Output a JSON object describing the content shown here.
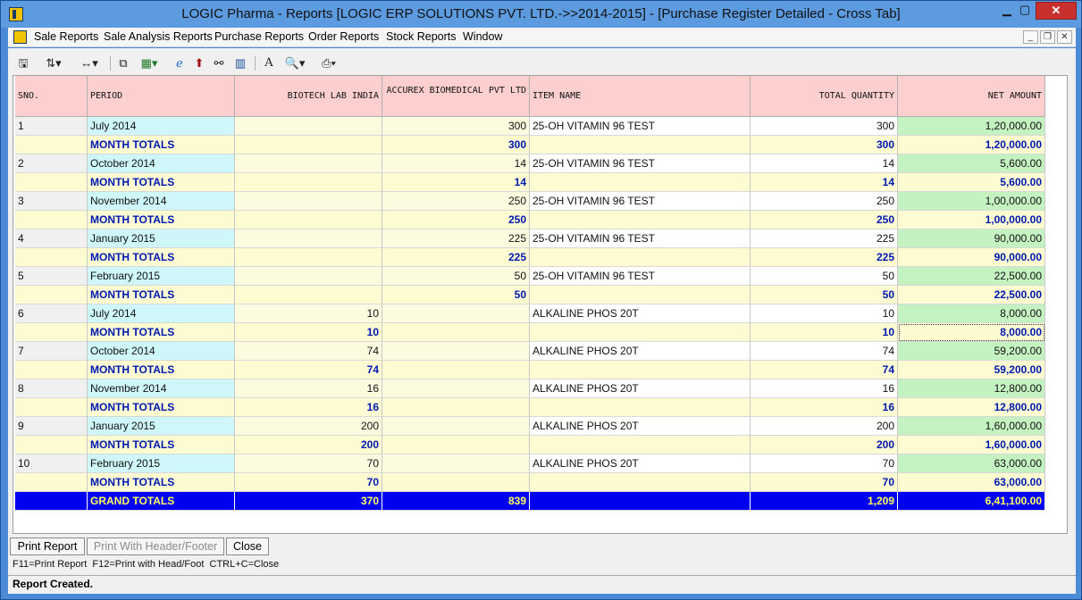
{
  "window": {
    "title": "LOGIC Pharma - Reports  [LOGIC ERP SOLUTIONS PVT. LTD.->>2014-2015] - [Purchase Register Detailed - Cross Tab]",
    "controls": {
      "minimize": "▁",
      "maximize": "▢",
      "close": "✕"
    }
  },
  "menu": {
    "items": [
      "Sale Reports",
      "Sale Analysis Reports",
      "Purchase Reports",
      "Order Reports",
      "Stock Reports",
      "Window"
    ],
    "mdi": {
      "minimize": "_",
      "restore": "❐",
      "close": "✕"
    }
  },
  "toolbar": {
    "icons": [
      "save-icon",
      "sort-icon",
      "column-width-icon",
      "copy-icon",
      "excel-icon",
      "internet-explorer-icon",
      "up-arrow-icon",
      "binoculars-icon",
      "chart-icon",
      "font-icon",
      "print-preview-icon",
      "printer-icon"
    ]
  },
  "table": {
    "headers": {
      "sno": "SNO.",
      "period": "PERIOD",
      "biotech": "BIOTECH LAB INDIA",
      "accurex": "ACCUREX BIOMEDICAL PVT LTD",
      "item": "ITEM NAME",
      "qty": "TOTAL QUANTITY",
      "net": "NET AMOUNT"
    },
    "rows": [
      {
        "type": "detail",
        "sno": "1",
        "period": "July 2014",
        "biotech": "",
        "accurex": "300",
        "item": "25-OH VITAMIN 96 TEST",
        "qty": "300",
        "net": "1,20,000.00"
      },
      {
        "type": "total",
        "sno": "",
        "period": "MONTH TOTALS",
        "biotech": "",
        "accurex": "300",
        "item": "",
        "qty": "300",
        "net": "1,20,000.00"
      },
      {
        "type": "detail",
        "sno": "2",
        "period": "October 2014",
        "biotech": "",
        "accurex": "14",
        "item": "25-OH VITAMIN 96 TEST",
        "qty": "14",
        "net": "5,600.00"
      },
      {
        "type": "total",
        "sno": "",
        "period": "MONTH TOTALS",
        "biotech": "",
        "accurex": "14",
        "item": "",
        "qty": "14",
        "net": "5,600.00"
      },
      {
        "type": "detail",
        "sno": "3",
        "period": "November 2014",
        "biotech": "",
        "accurex": "250",
        "item": "25-OH VITAMIN 96 TEST",
        "qty": "250",
        "net": "1,00,000.00"
      },
      {
        "type": "total",
        "sno": "",
        "period": "MONTH TOTALS",
        "biotech": "",
        "accurex": "250",
        "item": "",
        "qty": "250",
        "net": "1,00,000.00"
      },
      {
        "type": "detail",
        "sno": "4",
        "period": "January 2015",
        "biotech": "",
        "accurex": "225",
        "item": "25-OH VITAMIN 96 TEST",
        "qty": "225",
        "net": "90,000.00"
      },
      {
        "type": "total",
        "sno": "",
        "period": "MONTH TOTALS",
        "biotech": "",
        "accurex": "225",
        "item": "",
        "qty": "225",
        "net": "90,000.00"
      },
      {
        "type": "detail",
        "sno": "5",
        "period": "February 2015",
        "biotech": "",
        "accurex": "50",
        "item": "25-OH VITAMIN 96 TEST",
        "qty": "50",
        "net": "22,500.00"
      },
      {
        "type": "total",
        "sno": "",
        "period": "MONTH TOTALS",
        "biotech": "",
        "accurex": "50",
        "item": "",
        "qty": "50",
        "net": "22,500.00"
      },
      {
        "type": "detail",
        "sno": "6",
        "period": "July 2014",
        "biotech": "10",
        "accurex": "",
        "item": "ALKALINE PHOS 20T",
        "qty": "10",
        "net": "8,000.00"
      },
      {
        "type": "total",
        "sno": "",
        "period": "MONTH TOTALS",
        "biotech": "10",
        "accurex": "",
        "item": "",
        "qty": "10",
        "net": "8,000.00",
        "focused": true
      },
      {
        "type": "detail",
        "sno": "7",
        "period": "October 2014",
        "biotech": "74",
        "accurex": "",
        "item": "ALKALINE PHOS 20T",
        "qty": "74",
        "net": "59,200.00"
      },
      {
        "type": "total",
        "sno": "",
        "period": "MONTH TOTALS",
        "biotech": "74",
        "accurex": "",
        "item": "",
        "qty": "74",
        "net": "59,200.00"
      },
      {
        "type": "detail",
        "sno": "8",
        "period": "November 2014",
        "biotech": "16",
        "accurex": "",
        "item": "ALKALINE PHOS 20T",
        "qty": "16",
        "net": "12,800.00"
      },
      {
        "type": "total",
        "sno": "",
        "period": "MONTH TOTALS",
        "biotech": "16",
        "accurex": "",
        "item": "",
        "qty": "16",
        "net": "12,800.00"
      },
      {
        "type": "detail",
        "sno": "9",
        "period": "January 2015",
        "biotech": "200",
        "accurex": "",
        "item": "ALKALINE PHOS 20T",
        "qty": "200",
        "net": "1,60,000.00"
      },
      {
        "type": "total",
        "sno": "",
        "period": "MONTH TOTALS",
        "biotech": "200",
        "accurex": "",
        "item": "",
        "qty": "200",
        "net": "1,60,000.00"
      },
      {
        "type": "detail",
        "sno": "10",
        "period": "February 2015",
        "biotech": "70",
        "accurex": "",
        "item": "ALKALINE PHOS 20T",
        "qty": "70",
        "net": "63,000.00"
      },
      {
        "type": "total",
        "sno": "",
        "period": "MONTH TOTALS",
        "biotech": "70",
        "accurex": "",
        "item": "",
        "qty": "70",
        "net": "63,000.00"
      },
      {
        "type": "grand",
        "sno": "",
        "period": "GRAND TOTALS",
        "biotech": "370",
        "accurex": "839",
        "item": "",
        "qty": "1,209",
        "net": "6,41,100.00"
      }
    ]
  },
  "buttons": {
    "print_report": "Print Report",
    "print_header_footer": "Print With Header/Footer",
    "close": "Close"
  },
  "shortcuts": "F11=Print Report  F12=Print with Head/Foot  CTRL+C=Close",
  "status": "Report Created."
}
